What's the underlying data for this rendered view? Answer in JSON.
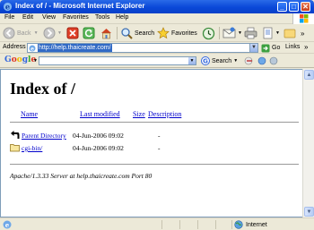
{
  "window": {
    "title": "Index of / - Microsoft Internet Explorer",
    "minimize_label": "_",
    "maximize_label": "□",
    "close_label": "✕"
  },
  "menu": [
    "File",
    "Edit",
    "View",
    "Favorites",
    "Tools",
    "Help"
  ],
  "toolbar": {
    "back_label": "Back",
    "search_label": "Search",
    "favorites_label": "Favorites"
  },
  "address": {
    "label": "Address",
    "url": "http://help.thaicreate.com/",
    "go_label": "Go",
    "links_label": "Links",
    "dropdown_symbol": "▼"
  },
  "google": {
    "logo": "Google",
    "search_label": "Search",
    "dropdown_symbol": "▼"
  },
  "page": {
    "heading": "Index of /",
    "columns": {
      "name": "Name",
      "last_modified": "Last modified",
      "size": "Size",
      "description": "Description"
    },
    "rows": [
      {
        "name": "Parent Directory",
        "modified": "04-Jun-2006 09:02",
        "size": "-",
        "icon": "back-arrow-icon"
      },
      {
        "name": "cgi-bin/",
        "modified": "04-Jun-2006 09:02",
        "size": "-",
        "icon": "folder-icon"
      }
    ],
    "server_line": "Apache/1.3.33 Server at help.thaicreate.com Port 80"
  },
  "status": {
    "zone": "Internet"
  },
  "colors": {
    "titlebar": "#0A48D8",
    "link": "#0000CC",
    "url_highlight": "#316AC5"
  }
}
